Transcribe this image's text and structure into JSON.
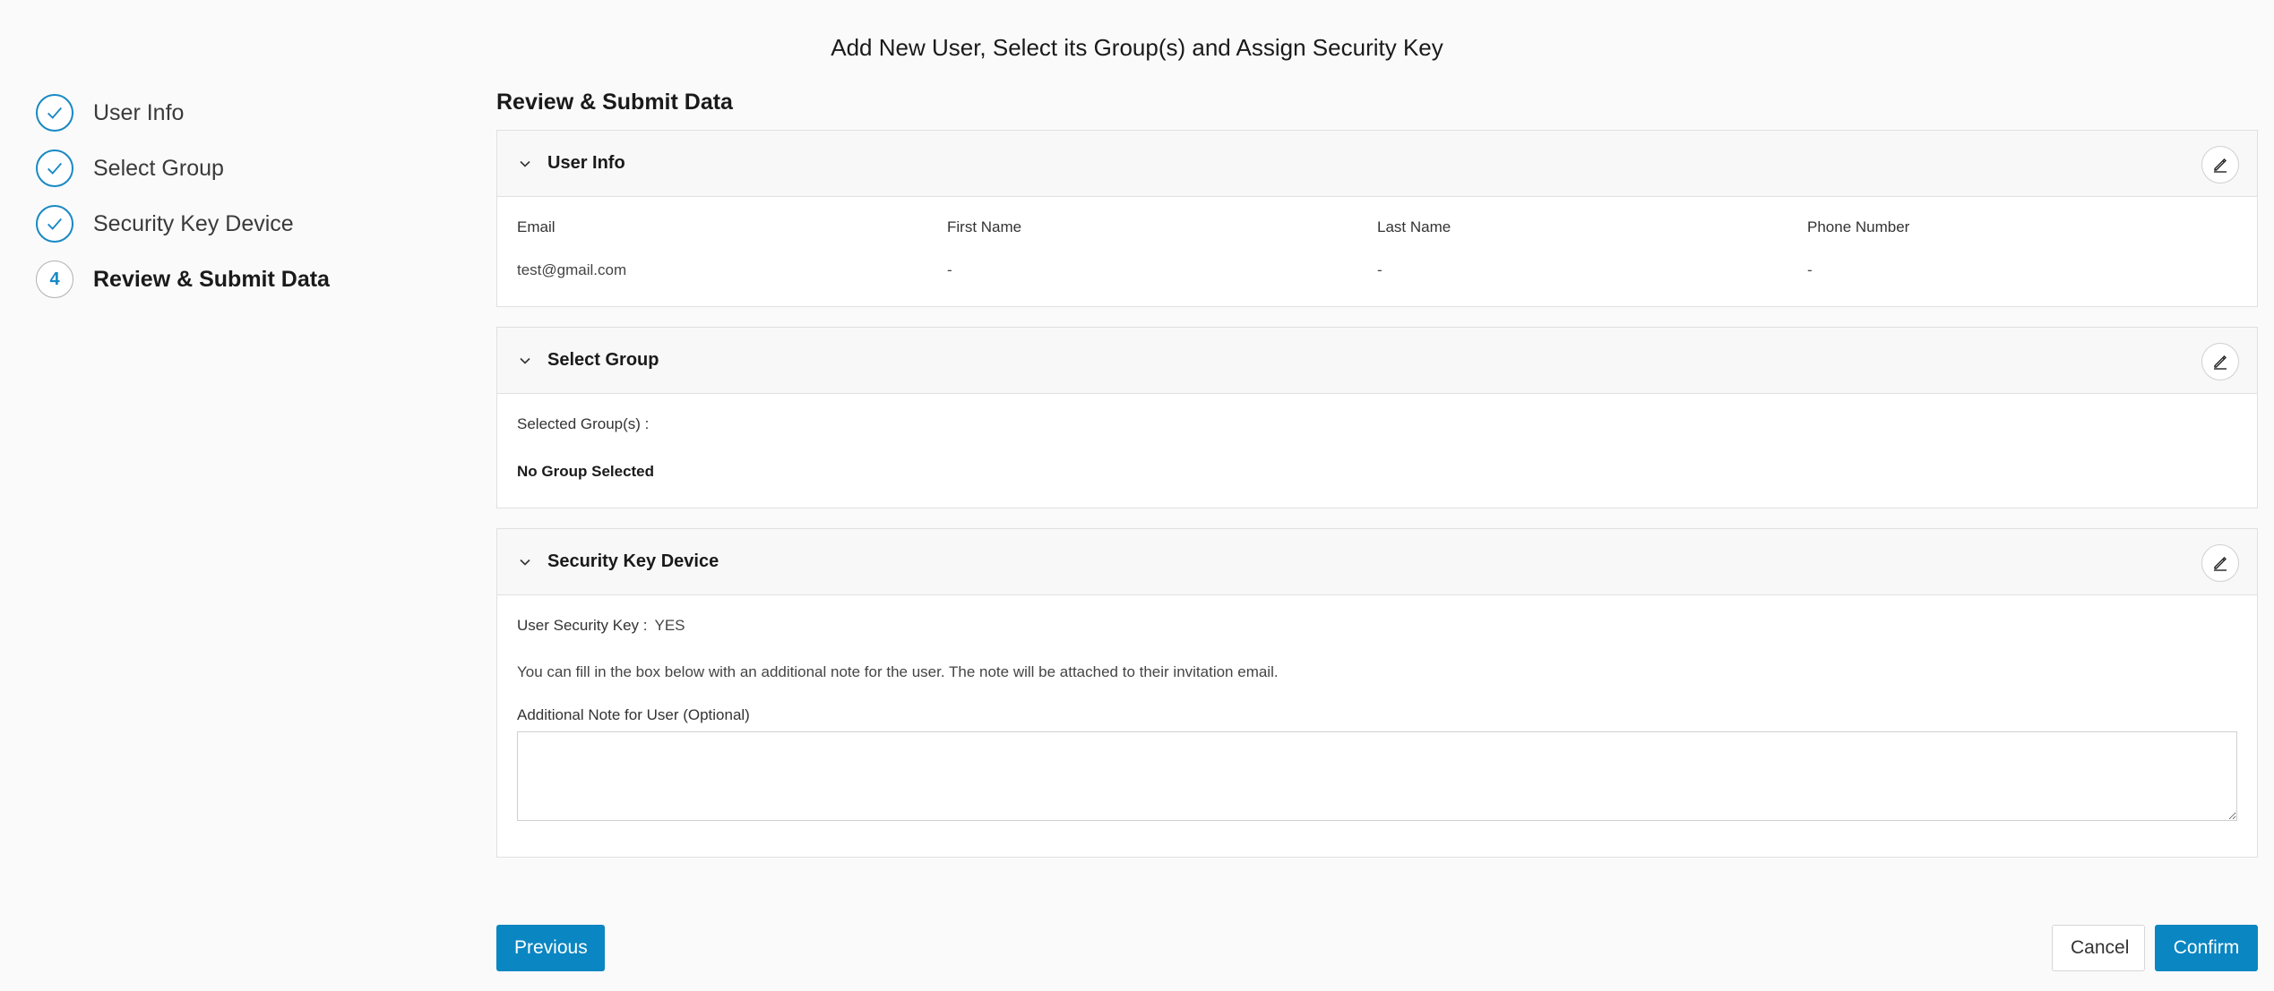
{
  "page": {
    "title": "Add New User, Select its Group(s) and Assign Security Key"
  },
  "stepper": {
    "steps": [
      {
        "label": "User Info",
        "status": "complete"
      },
      {
        "label": "Select Group",
        "status": "complete"
      },
      {
        "label": "Security Key Device",
        "status": "complete"
      },
      {
        "label": "Review & Submit Data",
        "status": "current",
        "number": "4"
      }
    ]
  },
  "review": {
    "heading": "Review & Submit Data",
    "user_info": {
      "title": "User Info",
      "fields": [
        {
          "label": "Email",
          "value": "test@gmail.com"
        },
        {
          "label": "First Name",
          "value": "-"
        },
        {
          "label": "Last Name",
          "value": "-"
        },
        {
          "label": "Phone Number",
          "value": "-"
        }
      ]
    },
    "select_group": {
      "title": "Select Group",
      "label": "Selected Group(s) :",
      "value": "No Group Selected"
    },
    "security_key": {
      "title": "Security Key Device",
      "key_label": "User Security Key :",
      "key_value": "YES",
      "note_info": "You can fill in the box below with an additional note for the user. The note will be attached to their invitation email.",
      "note_label": "Additional Note for User (Optional)",
      "note_value": ""
    }
  },
  "actions": {
    "previous": "Previous",
    "cancel": "Cancel",
    "confirm": "Confirm"
  },
  "icons": {
    "step_complete": "checkmark-icon",
    "section_toggle": "chevron-down-icon",
    "edit": "pencil-icon"
  },
  "colors": {
    "accent": "#0a86c2",
    "step_border": "#1889c4",
    "background": "#fafafa"
  }
}
